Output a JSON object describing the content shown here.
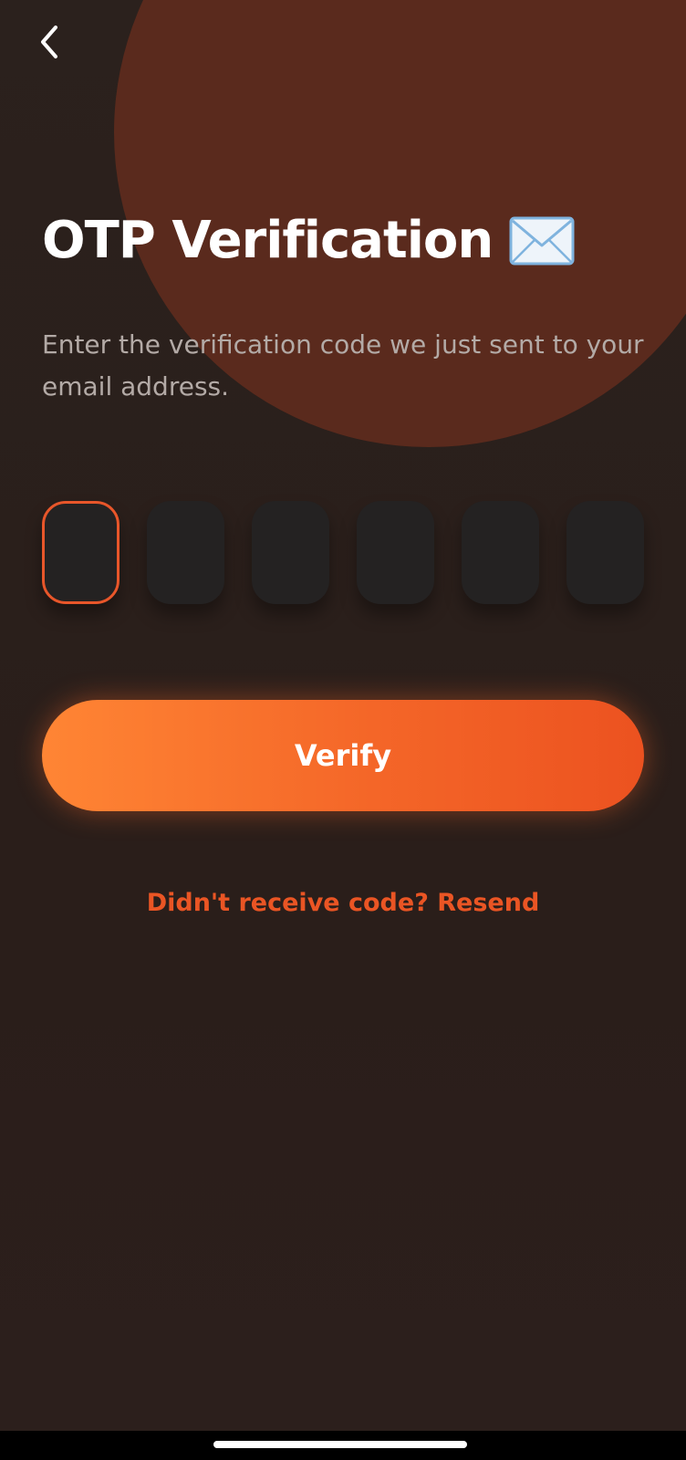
{
  "header": {
    "back_icon": "chevron-left-icon"
  },
  "main": {
    "title": "OTP Verification",
    "title_icon": "envelope-icon",
    "subtitle": "Enter the verification code we just sent to your email address.",
    "otp_boxes": [
      {
        "value": ""
      },
      {
        "value": ""
      },
      {
        "value": ""
      },
      {
        "value": ""
      },
      {
        "value": ""
      },
      {
        "value": ""
      }
    ],
    "verify_label": "Verify",
    "resend_label": "Didn't receive code? Resend"
  },
  "colors": {
    "accent": "#ea5524",
    "button_gradient_start": "#ff8534",
    "button_gradient_end": "#ec5220",
    "background": "#2a1f1c",
    "decorative_circle": "#5a2a1d",
    "otp_box": "#242222"
  }
}
